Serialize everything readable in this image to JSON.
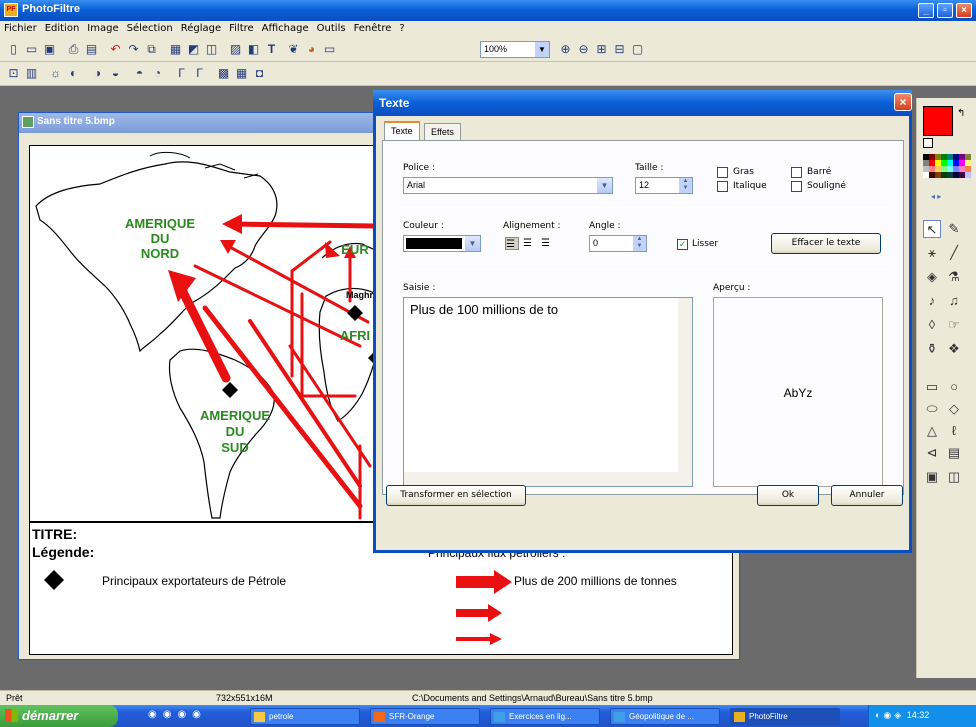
{
  "app": {
    "title": "PhotoFiltre"
  },
  "menu": [
    "Fichier",
    "Edition",
    "Image",
    "Sélection",
    "Réglage",
    "Filtre",
    "Affichage",
    "Outils",
    "Fenêtre",
    "?"
  ],
  "toolbar": {
    "zoom": "100%"
  },
  "document": {
    "title": "Sans titre 5.bmp"
  },
  "map_labels": {
    "na_1": "AMERIQUE",
    "na_2": "DU",
    "na_3": "NORD",
    "sa_1": "AMERIQUE",
    "sa_2": "DU",
    "sa_3": "SUD",
    "eu": "EUR",
    "maghreb": "Maghreb",
    "af": "AFRI"
  },
  "legend": {
    "titre": "TITRE:",
    "legende": "Légende:",
    "exporters": "Principaux exportateurs de Pétrole",
    "flux_title": "Principaux flux pétroliers :",
    "flux_200": "Plus de 200 millions de tonnes"
  },
  "dialog": {
    "title": "Texte",
    "tabs": [
      "Texte",
      "Effets"
    ],
    "police_label": "Police :",
    "police_value": "Arial",
    "taille_label": "Taille :",
    "taille_value": "12",
    "gras": "Gras",
    "italique": "Italique",
    "barre": "Barré",
    "souligne": "Souligné",
    "couleur_label": "Couleur :",
    "couleur_value": "#000000",
    "alignement_label": "Alignement :",
    "angle_label": "Angle :",
    "angle_value": "0",
    "lisser": "Lisser",
    "effacer": "Effacer le texte",
    "saisie_label": "Saisie :",
    "saisie_value": "Plus de 100 millions de to",
    "apercu_label": "Aperçu :",
    "apercu_value": "AbYz",
    "transformer": "Transformer en sélection",
    "ok": "Ok",
    "annuler": "Annuler"
  },
  "status": {
    "state": "Prêt",
    "size": "732x551x16M",
    "path": "C:\\Documents and Settings\\Arnaud\\Bureau\\Sans titre 5.bmp"
  },
  "taskbar": {
    "start": "démarrer",
    "tasks": [
      "petrole",
      "SFR-Orange",
      "Exercices en lig...",
      "Géopolitique de ...",
      "PhotoFiltre"
    ],
    "clock": "14:32"
  },
  "colors": {
    "primary": "#ff0000",
    "secondary": "#ffffff",
    "arrow": "#e81010",
    "labels": "#2a8a1f"
  }
}
